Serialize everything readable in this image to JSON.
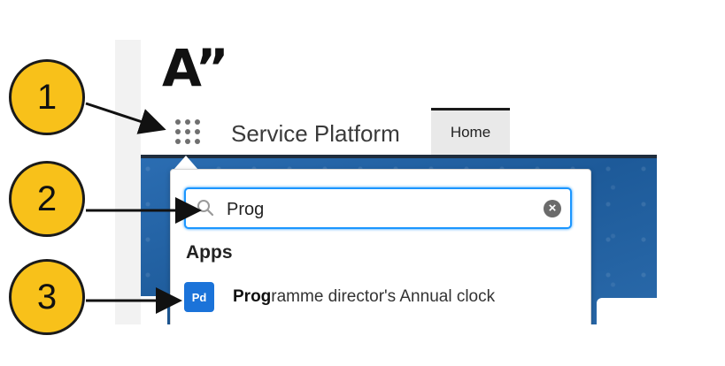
{
  "logo": {
    "text": "A”"
  },
  "header": {
    "app_launcher_icon": "app-launcher-grid-icon",
    "app_name": "Service Platform",
    "tabs": [
      {
        "label": "Home"
      }
    ]
  },
  "search": {
    "value": "Prog",
    "search_icon": "magnifier-icon",
    "clear_icon": "clear-circle-x-icon",
    "clear_glyph": "×"
  },
  "results": {
    "section_label": "Apps",
    "items": [
      {
        "badge": "Pd",
        "match": "Prog",
        "rest": "ramme director's Annual clock"
      }
    ]
  },
  "callouts": [
    {
      "number": "1"
    },
    {
      "number": "2"
    },
    {
      "number": "3"
    }
  ],
  "colors": {
    "callout_fill": "#f8c11a",
    "focus_blue": "#1b96ff",
    "badge_blue": "#1b73d9",
    "banner_blue": "#1f5c9c"
  }
}
